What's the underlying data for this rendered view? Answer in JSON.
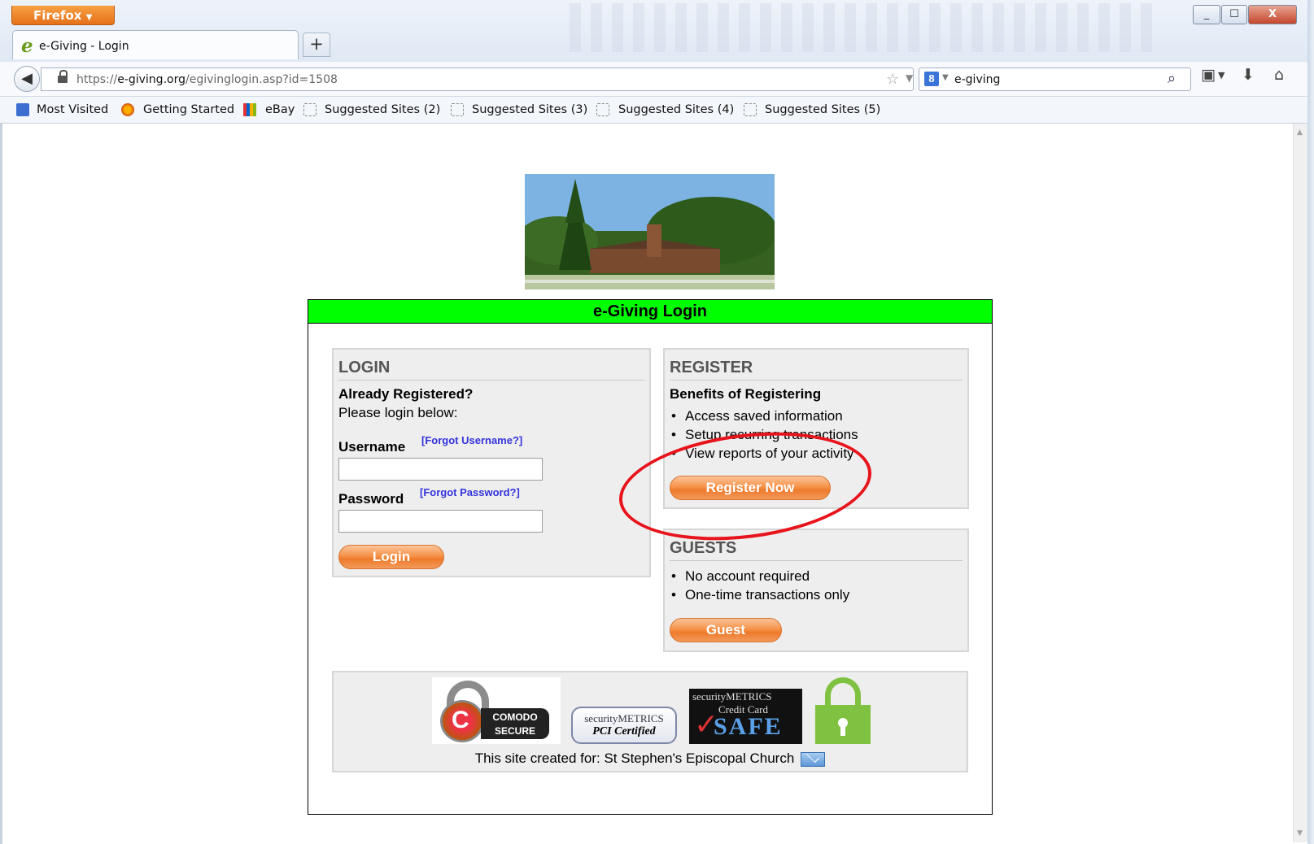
{
  "browser": {
    "menu_button": "Firefox",
    "window_controls": {
      "minimize": "_",
      "maximize": "☐",
      "close": "X"
    },
    "tab": {
      "title": "e-Giving - Login",
      "new_tab_label": "+"
    },
    "url": {
      "scheme": "https://",
      "host": "e-giving.org",
      "path": "/egivinglogin.asp?id=1508"
    },
    "search": {
      "engine_badge": "8",
      "value": "e-giving"
    },
    "icons": [
      "back-arrow-icon",
      "lock-icon",
      "star-icon",
      "reload-icon",
      "search-icon",
      "bookmarks-icon",
      "download-icon",
      "home-icon"
    ],
    "bookmarks": [
      {
        "label": "Most Visited"
      },
      {
        "label": "Getting Started"
      },
      {
        "label": "eBay"
      },
      {
        "label": "Suggested Sites (2)"
      },
      {
        "label": "Suggested Sites (3)"
      },
      {
        "label": "Suggested Sites (4)"
      },
      {
        "label": "Suggested Sites (5)"
      }
    ]
  },
  "page": {
    "title": "e-Giving Login",
    "title_bg": "#00ff00",
    "login": {
      "heading": "LOGIN",
      "subheading": "Already Registered?",
      "instruction": "Please login below:",
      "username_label": "Username",
      "forgot_username": "[Forgot Username?]",
      "username_value": "",
      "password_label": "Password",
      "forgot_password": "[Forgot Password?]",
      "password_value": "",
      "button": "Login"
    },
    "register": {
      "heading": "REGISTER",
      "subheading": "Benefits of Registering",
      "benefits": [
        "Access saved information",
        "Setup recurring transactions",
        "View reports of your activity"
      ],
      "button": "Register Now"
    },
    "guests": {
      "heading": "GUESTS",
      "items": [
        "No account required",
        "One-time transactions only"
      ],
      "button": "Guest"
    },
    "badges": {
      "comodo": [
        "COMODO",
        "SECURE"
      ],
      "pci": [
        "securityMETRICS",
        "PCI Certified"
      ],
      "safe": [
        "securityMETRICS",
        "Credit Card",
        "SAFE"
      ],
      "credit_text": "This site created for: St Stephen's Episcopal Church"
    },
    "accent_color": "#f07a30",
    "annotation_color": "#e8141b"
  }
}
